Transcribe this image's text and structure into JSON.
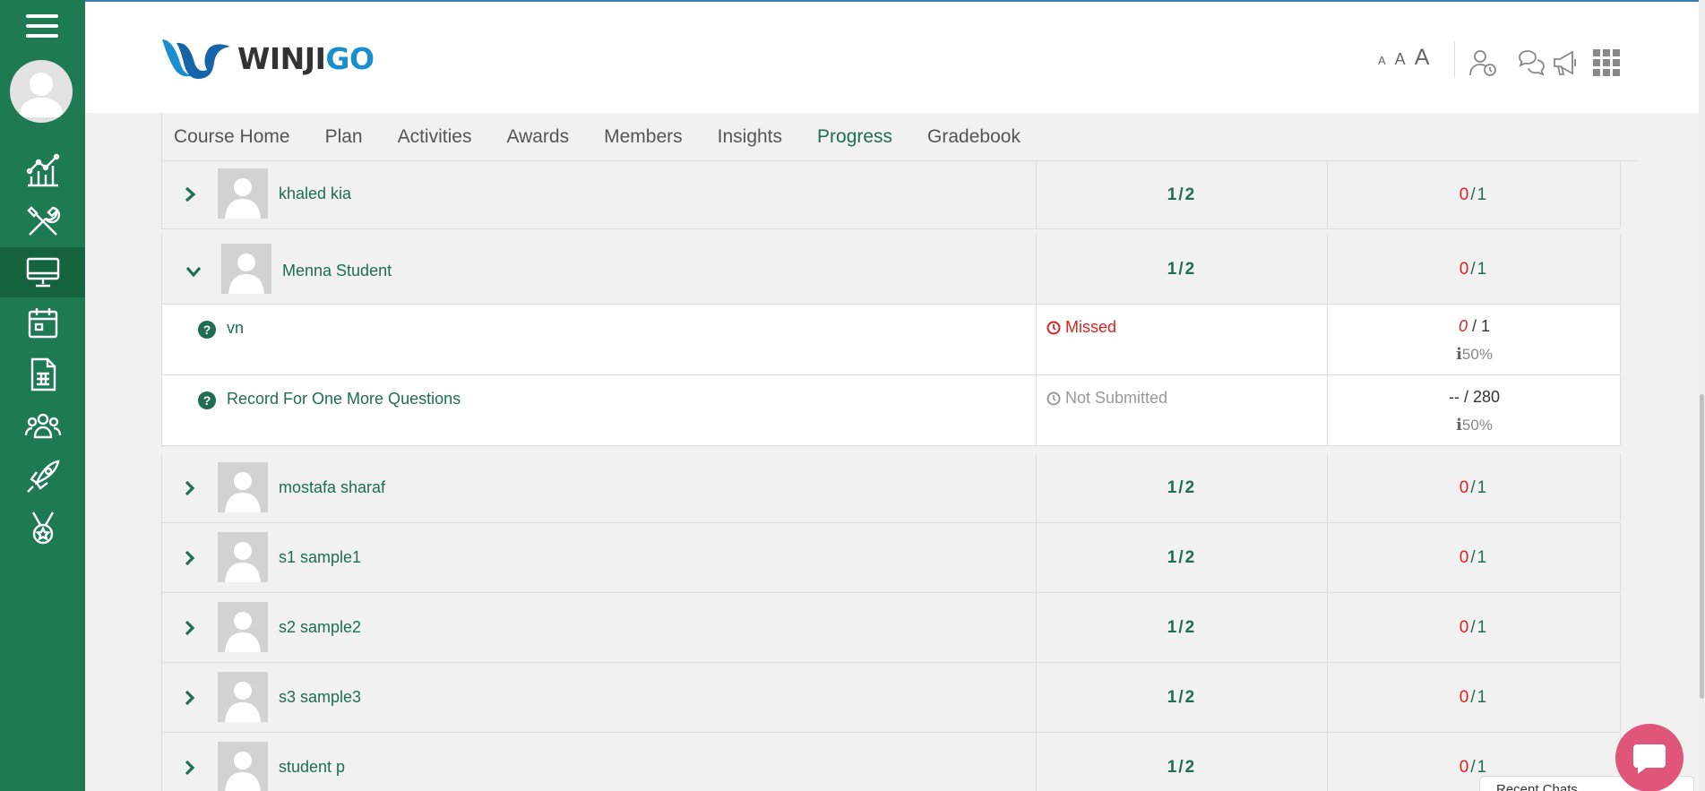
{
  "header": {
    "logo_winji": "WINJI",
    "logo_go": "GO",
    "font_sizes": [
      "A",
      "A",
      "A"
    ]
  },
  "tabs": [
    {
      "label": "Course Home"
    },
    {
      "label": "Plan"
    },
    {
      "label": "Activities"
    },
    {
      "label": "Awards"
    },
    {
      "label": "Members"
    },
    {
      "label": "Insights"
    },
    {
      "label": "Progress"
    },
    {
      "label": "Gradebook"
    }
  ],
  "active_tab": "Progress",
  "students": [
    {
      "name": "khaled kia",
      "completion": "1/2",
      "score_got": "0",
      "score_total": "/1"
    },
    {
      "name": "Menna Student",
      "completion": "1/2",
      "score_got": "0",
      "score_total": "/1"
    },
    {
      "name": "mostafa sharaf",
      "completion": "1/2",
      "score_got": "0",
      "score_total": "/1"
    },
    {
      "name": "s1 sample1",
      "completion": "1/2",
      "score_got": "0",
      "score_total": "/1"
    },
    {
      "name": "s2 sample2",
      "completion": "1/2",
      "score_got": "0",
      "score_total": "/1"
    },
    {
      "name": "s3 sample3",
      "completion": "1/2",
      "score_got": "0",
      "score_total": "/1"
    },
    {
      "name": "student p",
      "completion": "1/2",
      "score_got": "0",
      "score_total": "/1"
    }
  ],
  "expanded_activities": [
    {
      "name": "vn",
      "status": "Missed",
      "score_got": "0",
      "score_total": " / 1",
      "weight": "50%"
    },
    {
      "name": "Record For One More Questions",
      "status": "Not Submitted",
      "score_got": "--",
      "score_total": " / 280",
      "weight": "50%"
    }
  ],
  "chat": {
    "recent_label": "Recent Chats"
  },
  "colors": {
    "sidebar": "#1e7a52",
    "accent": "#1e6e4f",
    "danger": "#e02020",
    "chat": "#e0557a"
  }
}
